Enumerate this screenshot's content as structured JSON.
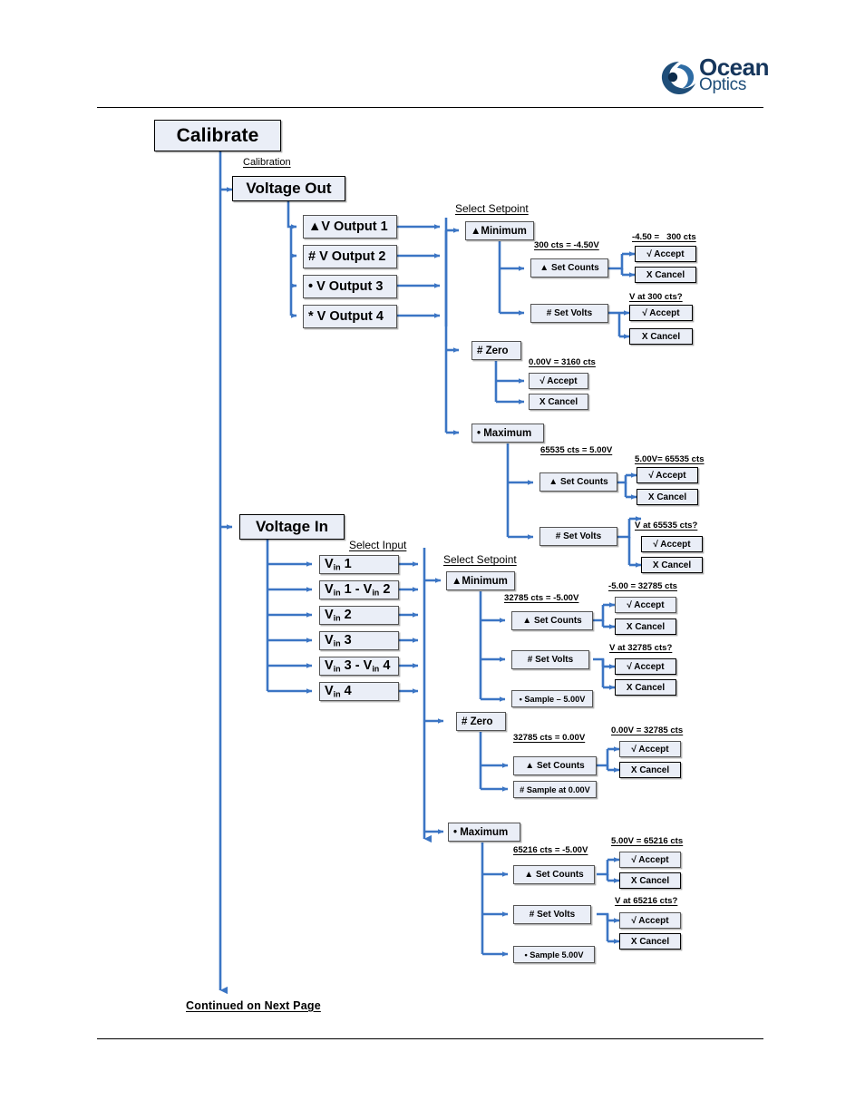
{
  "logo": {
    "name_line1": "Ocean",
    "name_line2": "Optics",
    "icon": "ocean-optics-swirl-icon"
  },
  "flow": {
    "root": {
      "label": "Calibrate"
    },
    "captions": {
      "calibration": "Calibration",
      "select_setpoint_out": "Select Setpoint",
      "select_input": "Select Input",
      "select_setpoint_in": "Select Setpoint"
    },
    "footer_note": "Continued on Next Page",
    "voltage_out": {
      "label": "Voltage Out",
      "outputs": [
        {
          "label": "▲V Output 1"
        },
        {
          "label": "# V Output 2"
        },
        {
          "label": "• V Output 3"
        },
        {
          "label": "* V Output 4"
        }
      ],
      "minimum": {
        "label": "▲Minimum",
        "set_counts": {
          "caption": "300 cts = -4.50V",
          "label": "▲ Set Counts",
          "result_caption": "-4.50 =   300 cts",
          "accept": "√ Accept",
          "cancel": "X Cancel"
        },
        "set_volts": {
          "label": "# Set Volts",
          "result_caption": "V at 300 cts?",
          "accept": "√ Accept",
          "cancel": "X Cancel"
        }
      },
      "zero": {
        "label": "# Zero",
        "caption": "0.00V = 3160 cts",
        "accept": "√ Accept",
        "cancel": "X Cancel"
      },
      "maximum": {
        "label": "• Maximum",
        "set_counts": {
          "caption": "65535 cts = 5.00V",
          "label": "▲ Set Counts",
          "result_caption": "5.00V= 65535 cts",
          "accept": "√ Accept",
          "cancel": "X Cancel"
        },
        "set_volts": {
          "label": "# Set Volts",
          "result_caption": "V at 65535 cts?",
          "accept": "√ Accept",
          "cancel": "X Cancel"
        }
      }
    },
    "voltage_in": {
      "label": "Voltage In",
      "inputs": [
        {
          "prefix": "V",
          "sub": "in",
          "rest": " 1"
        },
        {
          "prefix": "V",
          "sub": "in",
          "rest": " 1 - V",
          "sub2": "in",
          "rest2": " 2"
        },
        {
          "prefix": "V",
          "sub": "in",
          "rest": " 2"
        },
        {
          "prefix": "V",
          "sub": "in",
          "rest": " 3"
        },
        {
          "prefix": "V",
          "sub": "in",
          "rest": " 3 - V",
          "sub2": "in",
          "rest2": " 4"
        },
        {
          "prefix": "V",
          "sub": "in",
          "rest": " 4"
        }
      ],
      "minimum": {
        "label": "▲Minimum",
        "set_counts": {
          "caption": "32785 cts = -5.00V",
          "label": "▲ Set Counts",
          "result_caption": "-5.00 = 32785 cts",
          "accept": "√ Accept",
          "cancel": "X Cancel"
        },
        "set_volts": {
          "label": "# Set Volts",
          "result_caption": "V at 32785 cts?",
          "accept": "√ Accept",
          "cancel": "X Cancel"
        },
        "sample": {
          "label": "• Sample – 5.00V"
        }
      },
      "zero": {
        "label": "# Zero",
        "set_counts": {
          "caption": "32785 cts = 0.00V",
          "label": "▲ Set Counts",
          "result_caption": "0.00V = 32785 cts",
          "accept": "√ Accept",
          "cancel": "X Cancel"
        },
        "sample": {
          "label": "# Sample at 0.00V"
        }
      },
      "maximum": {
        "label": "• Maximum",
        "set_counts": {
          "caption": "65216 cts = -5.00V",
          "label": "▲ Set Counts",
          "result_caption": "5.00V = 65216 cts",
          "accept": "√ Accept",
          "cancel": "X Cancel"
        },
        "set_volts": {
          "label": "# Set Volts",
          "result_caption": "V at 65216 cts?",
          "accept": "√ Accept",
          "cancel": "X Cancel"
        },
        "sample": {
          "label": "• Sample 5.00V"
        }
      }
    }
  },
  "colors": {
    "wire": "#3b75c4",
    "node_fill": "#eaeef7",
    "node_border": "#808080",
    "brand": "#16365c"
  }
}
